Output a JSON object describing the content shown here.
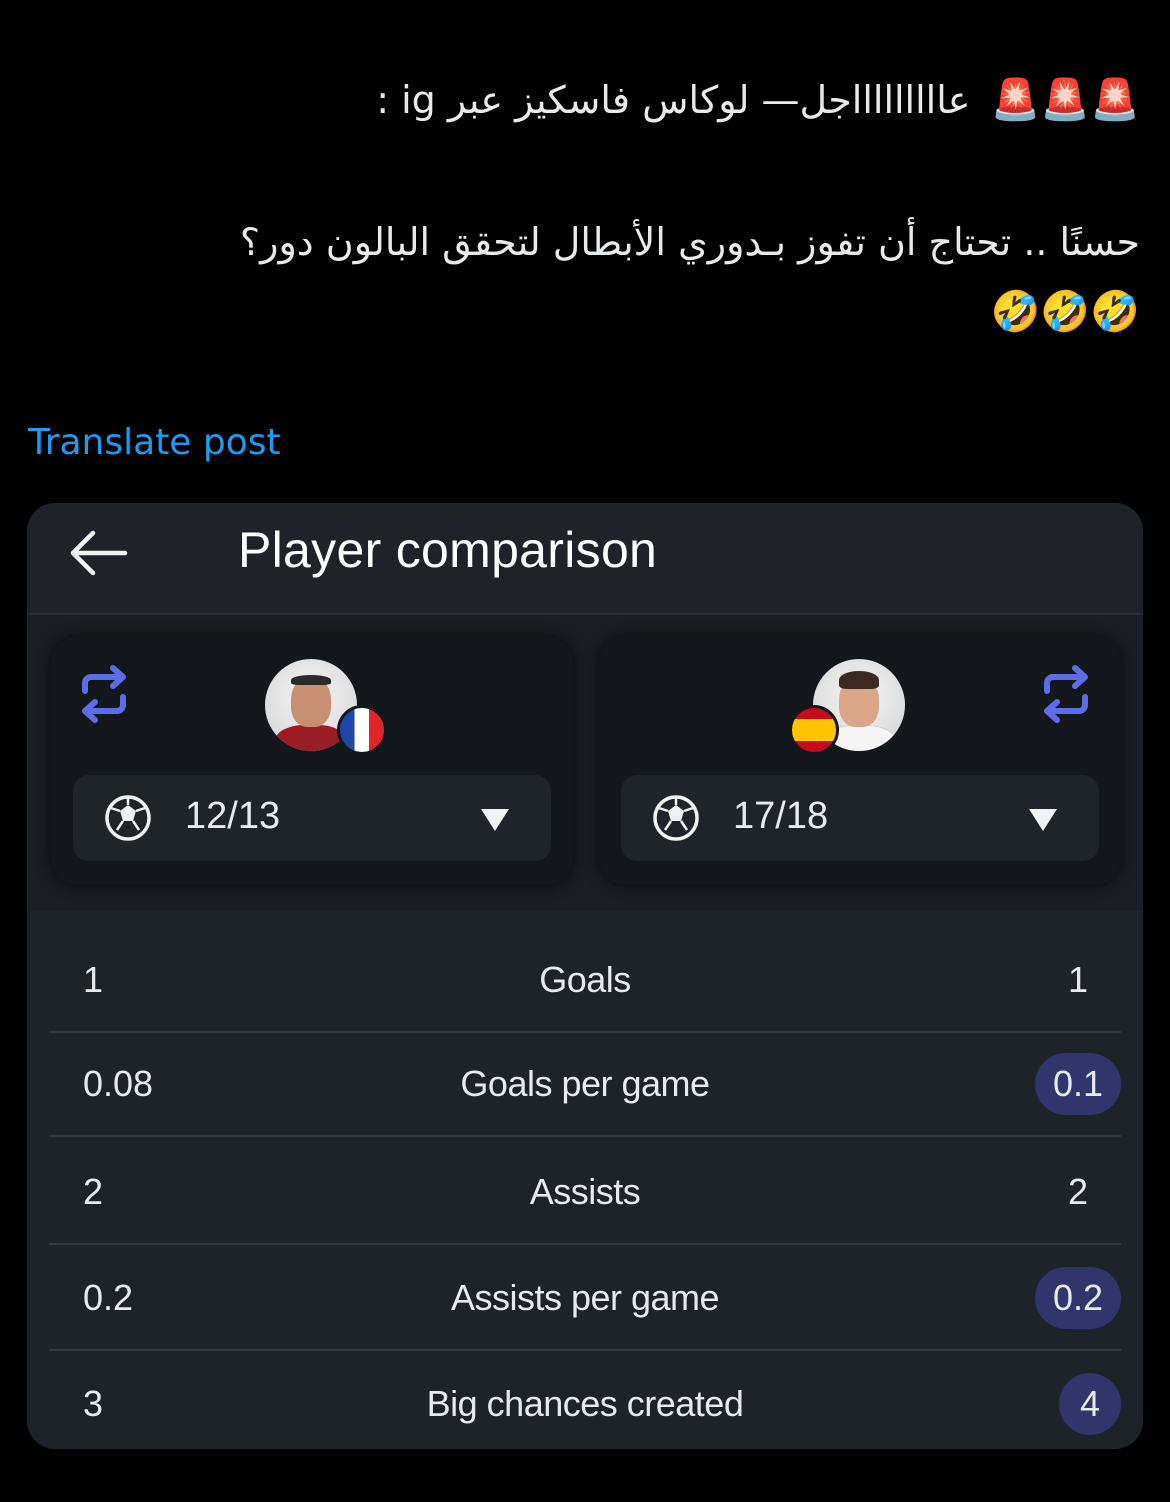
{
  "post": {
    "line1_sirens": "🚨🚨🚨",
    "line1_text": "عاااااااااجل— لوكاس فاسكيز عبر ig :",
    "line2_text": "حسنًا .. تحتاج أن تفوز بـدوري الأبطال لتحقق البالون دور؟",
    "line3_emojis": "🤣🤣🤣",
    "translate_label": "Translate post"
  },
  "app": {
    "title": "Player comparison",
    "left_player": {
      "season": "12/13",
      "flag": "france",
      "competition_icon": "champions-league-ball-icon"
    },
    "right_player": {
      "season": "17/18",
      "flag": "spain",
      "competition_icon": "champions-league-ball-icon"
    },
    "stats": [
      {
        "label": "Goals",
        "left": "1",
        "right": "1",
        "right_highlight": false
      },
      {
        "label": "Goals per game",
        "left": "0.08",
        "right": "0.1",
        "right_highlight": true
      },
      {
        "label": "Assists",
        "left": "2",
        "right": "2",
        "right_highlight": false
      },
      {
        "label": "Assists per game",
        "left": "0.2",
        "right": "0.2",
        "right_highlight": true
      },
      {
        "label": "Big chances created",
        "left": "3",
        "right": "4",
        "right_highlight": true
      }
    ]
  },
  "colors": {
    "link": "#1d9bf0",
    "highlight_pill": "#30356b",
    "swap_icon": "#5b6ee8"
  }
}
